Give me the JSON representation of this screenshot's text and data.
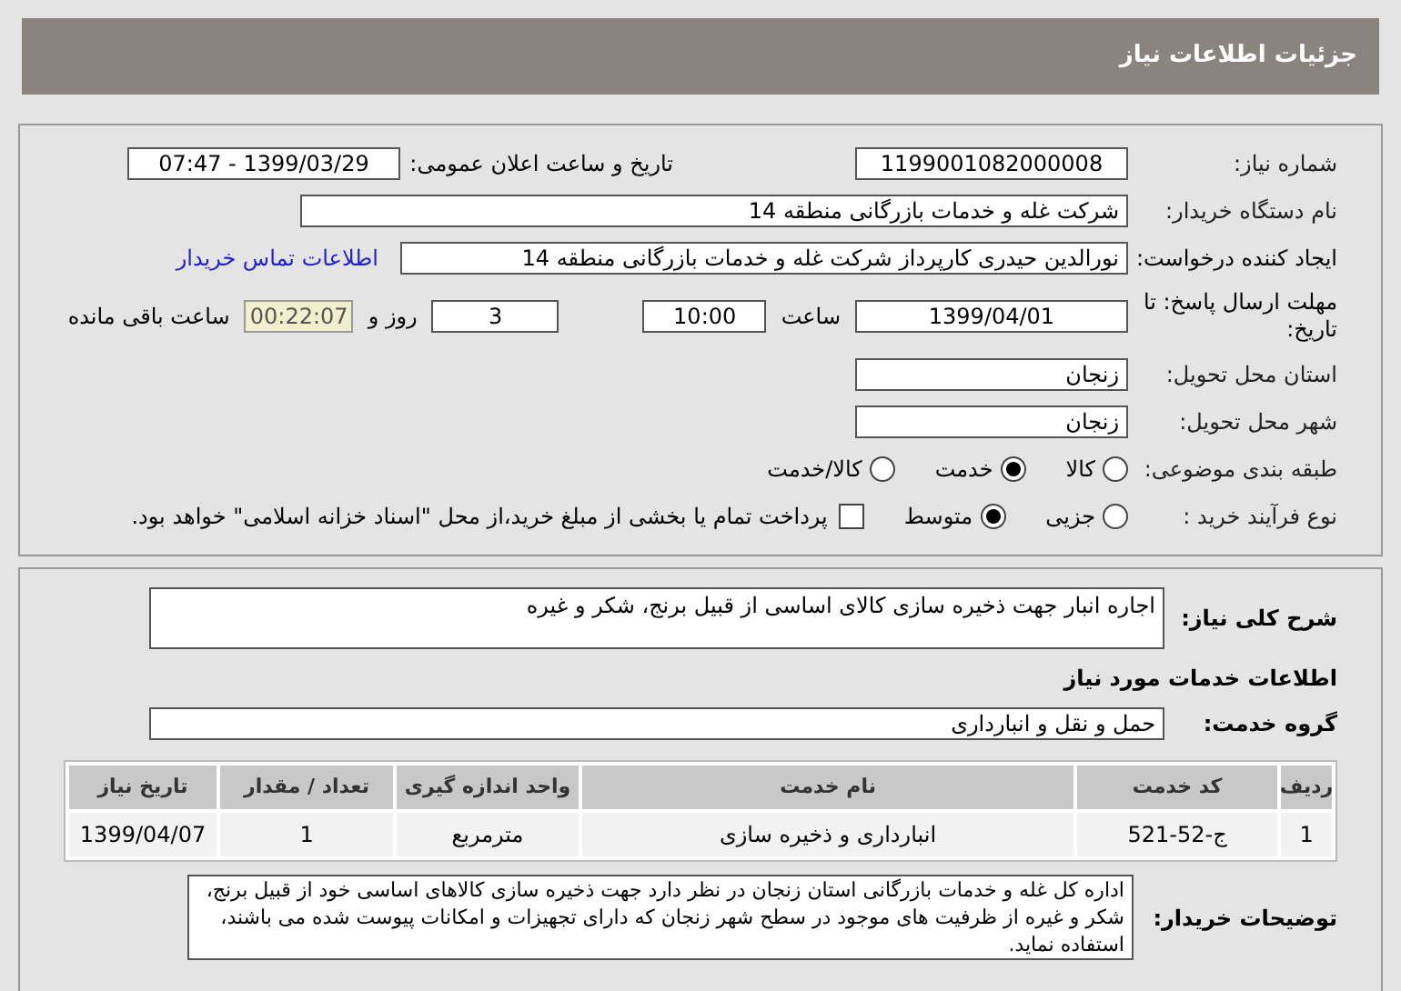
{
  "header": {
    "title": "جزئیات اطلاعات نیاز"
  },
  "need_number": {
    "label": "شماره نیاز:",
    "value": "1199001082000008"
  },
  "announce": {
    "label": "تاریخ و ساعت اعلان عمومی:",
    "value": "1399/03/29 - 07:47"
  },
  "buyer_org": {
    "label": "نام دستگاه خریدار:",
    "value": "شرکت غله و خدمات بازرگانی منطقه 14"
  },
  "requester": {
    "label": "ایجاد کننده درخواست:",
    "value": "نورالدین حیدری کارپرداز شرکت غله و خدمات بازرگانی منطقه 14",
    "link": "اطلاعات تماس خریدار"
  },
  "deadline": {
    "label": "مهلت ارسال پاسخ: تا تاریخ:",
    "date": "1399/04/01",
    "time_label": "ساعت",
    "time": "10:00",
    "days": "3",
    "days_label": "روز و",
    "remaining": "00:22:07",
    "remaining_label": "ساعت باقی مانده"
  },
  "province": {
    "label": "استان محل تحویل:",
    "value": "زنجان"
  },
  "city": {
    "label": "شهر محل تحویل:",
    "value": "زنجان"
  },
  "category": {
    "label": "طبقه بندی موضوعی:",
    "options": [
      {
        "label": "کالا",
        "selected": false
      },
      {
        "label": "خدمت",
        "selected": true
      },
      {
        "label": "کالا/خدمت",
        "selected": false
      }
    ]
  },
  "process": {
    "label": "نوع فرآیند خرید :",
    "options": [
      {
        "label": "جزیی",
        "selected": false
      },
      {
        "label": "متوسط",
        "selected": true
      }
    ],
    "payment": {
      "checked": false,
      "text": "پرداخت تمام یا بخشی از مبلغ خرید،از محل \"اسناد خزانه اسلامی\" خواهد بود."
    }
  },
  "description": {
    "label": "شرح کلی نیاز:",
    "value": "اجاره انبار جهت ذخیره سازی کالای اساسی از قبیل برنج، شکر و غیره"
  },
  "services_title": "اطلاعات خدمات مورد نیاز",
  "service_group": {
    "label": "گروه خدمت:",
    "value": "حمل و نقل و انبارداری"
  },
  "table": {
    "columns": [
      "ردیف",
      "کد خدمت",
      "نام خدمت",
      "واحد اندازه گیری",
      "تعداد / مقدار",
      "تاریخ نیاز"
    ],
    "rows": [
      [
        "1",
        "ج-52-521",
        "انبارداری و ذخیره سازی",
        "مترمربع",
        "1",
        "1399/04/07"
      ]
    ]
  },
  "buyer_notes": {
    "label": "توضیحات خریدار:",
    "value": "اداره کل غله و خدمات بازرگانی استان زنجان در نظر دارد جهت ذخیره سازی کالاهای اساسی خود از قبیل برنج، شکر و غیره از ظرفیت های موجود در سطح شهر زنجان که دارای تجهیزات و امکانات پیوست شده می باشند،  استفاده نماید."
  }
}
